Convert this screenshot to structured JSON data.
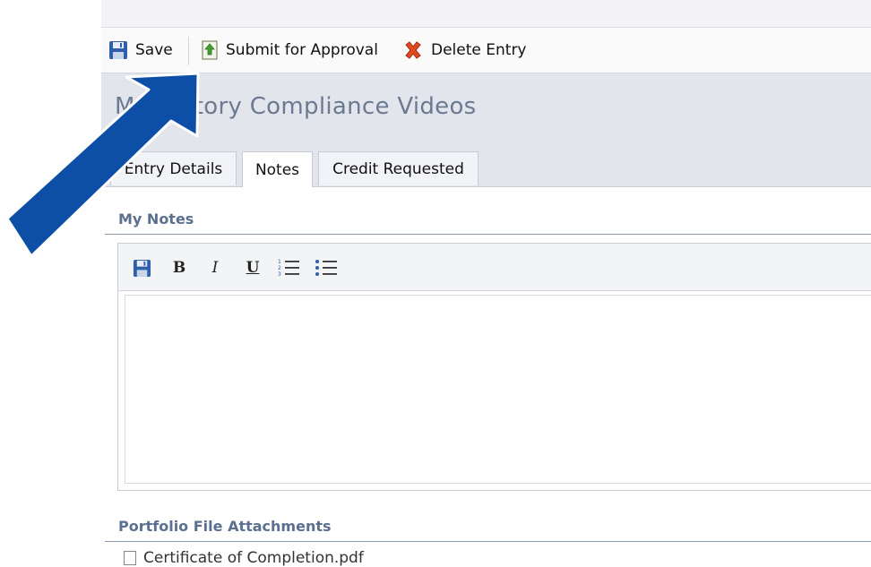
{
  "toolbar": {
    "save_label": "Save",
    "submit_label": "Submit for Approval",
    "delete_label": "Delete Entry"
  },
  "page": {
    "title": "Mandatory Compliance Videos"
  },
  "tabs": [
    {
      "label": "Entry Details",
      "active": false
    },
    {
      "label": "Notes",
      "active": true
    },
    {
      "label": "Credit Requested",
      "active": false
    }
  ],
  "notes": {
    "section_title": "My Notes",
    "editor_value": ""
  },
  "attachments": {
    "section_title": "Portfolio File Attachments",
    "first_item": "Certificate of Completion.pdf"
  },
  "colors": {
    "arrow": "#0d4ea6",
    "section_title": "#5b6f8e",
    "page_title": "#6b7a92",
    "header_bg": "#e2e5ec"
  },
  "icons": {
    "save": "floppy-disk-icon",
    "submit": "document-upload-icon",
    "delete": "red-x-icon",
    "bold": "bold-icon",
    "italic": "italic-icon",
    "underline": "underline-icon",
    "ordered_list": "ordered-list-icon",
    "bullet_list": "bullet-list-icon"
  }
}
